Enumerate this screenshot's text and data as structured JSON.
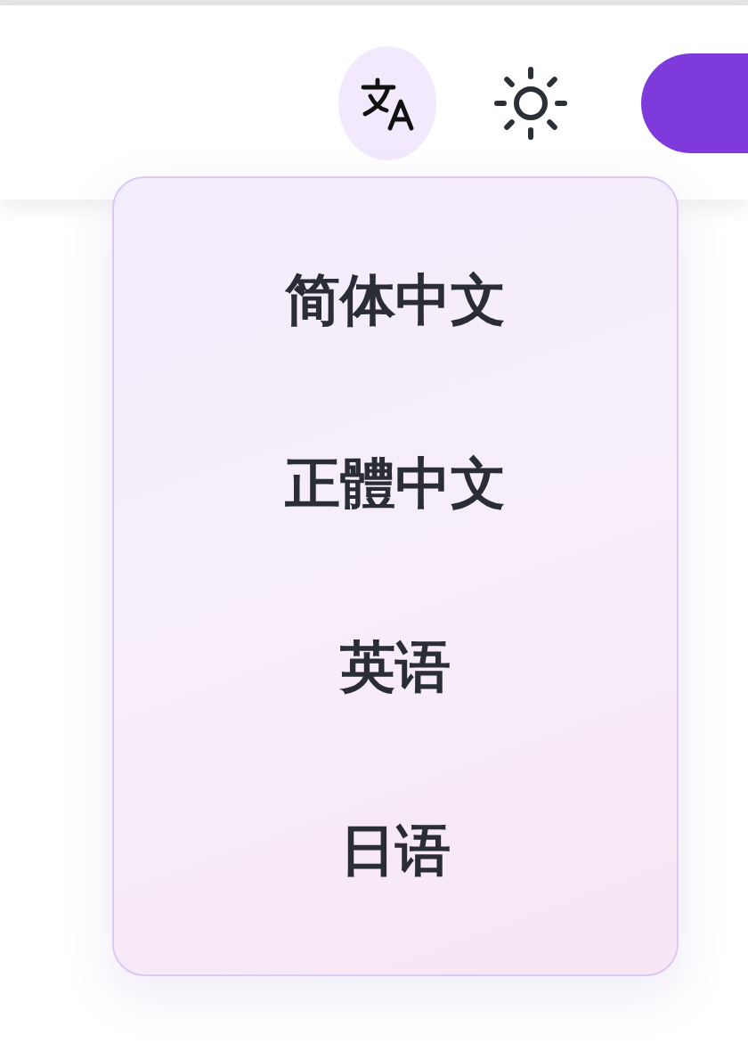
{
  "language_menu": {
    "items": [
      {
        "label": "简体中文"
      },
      {
        "label": "正體中文"
      },
      {
        "label": "英语"
      },
      {
        "label": "日语"
      }
    ]
  }
}
